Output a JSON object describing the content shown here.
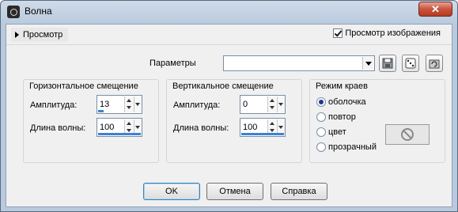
{
  "window": {
    "title": "Волна",
    "close_label": "✕"
  },
  "preview": {
    "toggle_label": "Просмотр",
    "image_preview_label": "Просмотр изображения",
    "image_preview_checked": true
  },
  "params": {
    "label": "Параметры",
    "combo_value": ""
  },
  "horizontal": {
    "title": "Горизонтальное смещение",
    "amplitude_label": "Амплитуда:",
    "amplitude_value": "13",
    "wavelength_label": "Длина волны:",
    "wavelength_value": "100"
  },
  "vertical": {
    "title": "Вертикальное смещение",
    "amplitude_label": "Амплитуда:",
    "amplitude_value": "0",
    "wavelength_label": "Длина волны:",
    "wavelength_value": "100"
  },
  "edge_mode": {
    "title": "Режим краев",
    "options": [
      {
        "label": "оболочка",
        "selected": true
      },
      {
        "label": "повтор",
        "selected": false
      },
      {
        "label": "цвет",
        "selected": false
      },
      {
        "label": "прозрачный",
        "selected": false
      }
    ]
  },
  "buttons": {
    "ok": "OK",
    "cancel": "Отмена",
    "help": "Справка"
  },
  "colors": {
    "accent": "#3c82d8",
    "title_bar": "#b9cade",
    "close": "#c9533c"
  }
}
